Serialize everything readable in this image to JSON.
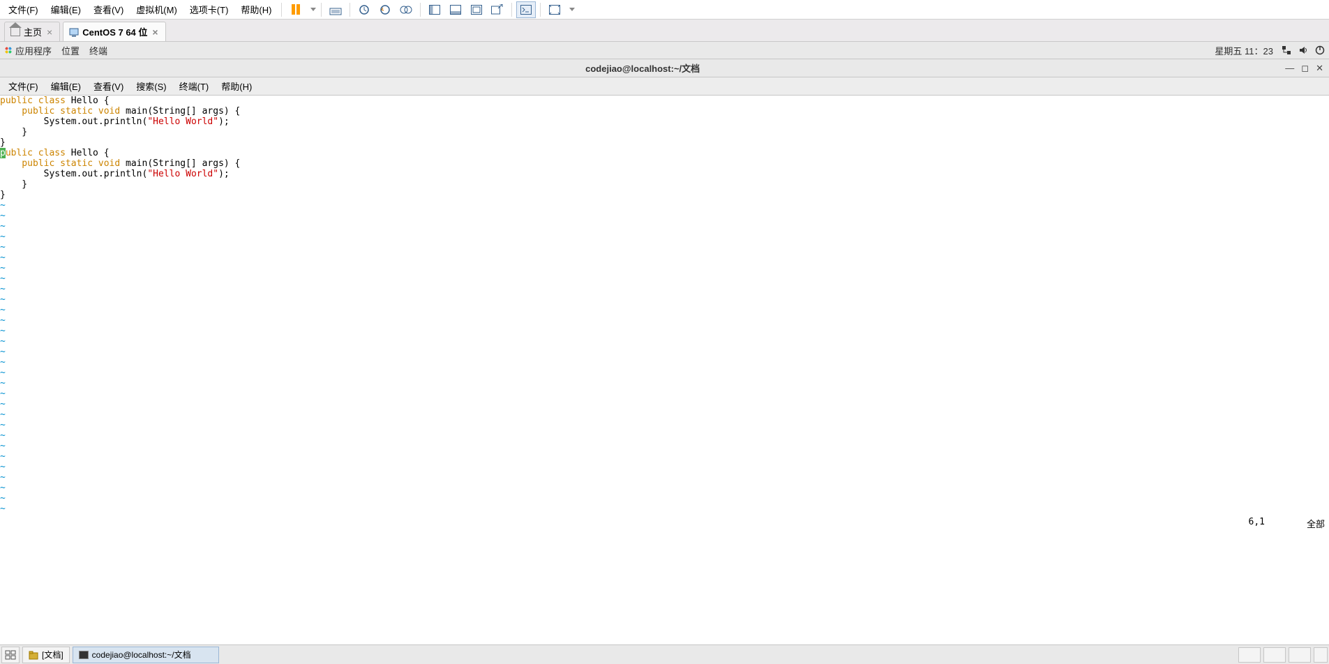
{
  "vm_menu": [
    "文件(F)",
    "编辑(E)",
    "查看(V)",
    "虚拟机(M)",
    "选项卡(T)",
    "帮助(H)"
  ],
  "tabs": {
    "home": "主页",
    "active": "CentOS 7 64 位"
  },
  "gnome": {
    "apps": "应用程序",
    "places": "位置",
    "terminal": "终端",
    "datetime": "星期五 11：23"
  },
  "terminal": {
    "title": "codejiao@localhost:~/文档",
    "menu": [
      "文件(F)",
      "编辑(E)",
      "查看(V)",
      "搜索(S)",
      "终端(T)",
      "帮助(H)"
    ]
  },
  "code": {
    "l1a": "public class",
    "l1b": " Hello {",
    "l2a": "    public static void",
    "l2b": " main(String[] args) {",
    "l3a": "        System.out.println(",
    "l3b": "\"Hello World\"",
    "l3c": ");",
    "l4": "    }",
    "l5": "}",
    "l6p": "p",
    "l6a": "ublic class",
    "l6b": " Hello {"
  },
  "vim": {
    "pos": "6,1",
    "mode": "全部"
  },
  "taskbar": {
    "docs": "[文档]",
    "term": "codejiao@localhost:~/文档"
  }
}
